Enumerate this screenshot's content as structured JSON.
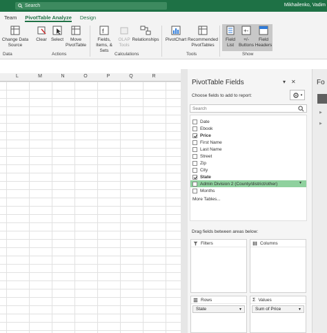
{
  "titlebar": {
    "search_placeholder": "Search",
    "user": "Mikhailenko, Vadim"
  },
  "tabs": [
    {
      "label": "Team"
    },
    {
      "label": "PivotTable Analyze"
    },
    {
      "label": "Design"
    }
  ],
  "ribbon": {
    "change_source": "Change Data Source",
    "clear": "Clear",
    "select": "Select",
    "move": "Move PivotTable",
    "fields": "Fields, Items, & Sets",
    "olap": "OLAP Tools",
    "relationships": "Relationships",
    "pivotchart": "PivotChart",
    "recommended": "Recommended PivotTables",
    "field_list": "Field List",
    "buttons": "+/- Buttons",
    "field_headers": "Field Headers",
    "groups": {
      "data": "Data",
      "actions": "Actions",
      "calculations": "Calculations",
      "tools": "Tools",
      "show": "Show"
    }
  },
  "columns": [
    "L",
    "M",
    "N",
    "O",
    "P",
    "Q",
    "R"
  ],
  "pivot": {
    "title": "PivotTable Fields",
    "choose_label": "Choose fields to add to report:",
    "search_placeholder": "Search",
    "fields": [
      {
        "label": "Date",
        "checked": false
      },
      {
        "label": "Ebook",
        "checked": false
      },
      {
        "label": "Price",
        "checked": true
      },
      {
        "label": "First Name",
        "checked": false
      },
      {
        "label": "Last Name",
        "checked": false
      },
      {
        "label": "Street",
        "checked": false
      },
      {
        "label": "Zip",
        "checked": false
      },
      {
        "label": "City",
        "checked": false
      },
      {
        "label": "State",
        "checked": true
      },
      {
        "label": "Admin Division 2 (County/district/other)",
        "checked": false
      },
      {
        "label": "Months",
        "checked": false
      }
    ],
    "more_tables": "More Tables...",
    "drag_label": "Drag fields between areas below:",
    "areas": {
      "filters": "Filters",
      "columns": "Columns",
      "rows": "Rows",
      "values": "Values",
      "rows_item": "State",
      "values_item": "Sum of Price"
    }
  },
  "right_pane": {
    "title": "Fo"
  }
}
